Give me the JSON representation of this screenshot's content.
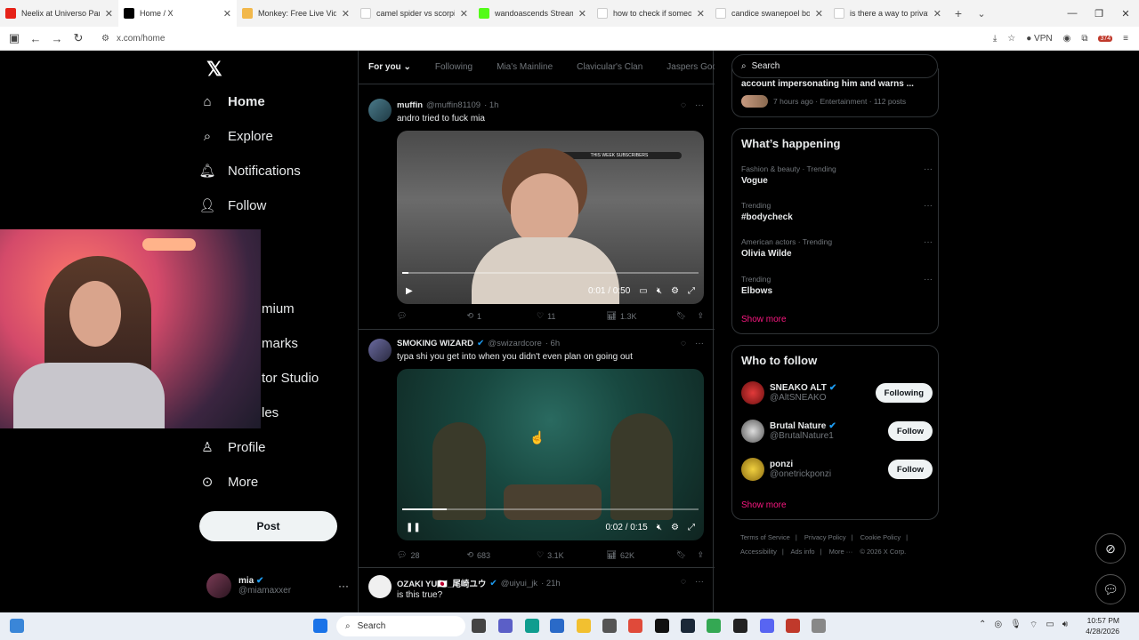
{
  "browser": {
    "tabs": [
      {
        "label": "Neelix at Universo Paralello",
        "color": "#e62117"
      },
      {
        "label": "Home / X",
        "color": "#000000"
      },
      {
        "label": "Monkey: Free Live Video Ch",
        "color": "#f2b84b"
      },
      {
        "label": "camel spider vs scorpion - G",
        "color": "#ffffff"
      },
      {
        "label": "wandoascends Stream - Wa",
        "color": "#53fc18"
      },
      {
        "label": "how to check if someone fo",
        "color": "#ffffff"
      },
      {
        "label": "candice swanepoel body - G",
        "color": "#ffffff"
      },
      {
        "label": "is there a way to private a li",
        "color": "#ffffff"
      }
    ],
    "url": "x.com/home",
    "vpn_label": "VPN",
    "badge_count": "374"
  },
  "x": {
    "nav": {
      "home": "Home",
      "explore": "Explore",
      "notifications": "Notifications",
      "follow": "Follow",
      "premium_partial": "mium",
      "bookmarks_partial": "marks",
      "creator_partial": "tor Studio",
      "articles_partial": "les",
      "profile": "Profile",
      "more": "More",
      "post": "Post"
    },
    "account": {
      "name": "mia",
      "handle": "@miamaxxer"
    },
    "tabs": [
      "For you",
      "Following",
      "Mia's Mainline",
      "Clavicular's Clan",
      "Jaspers Goon"
    ],
    "tweets": [
      {
        "name": "muffin",
        "handle": "@muffin81109",
        "time": "· 1h",
        "text": "andro tried to fuck mia",
        "video_time": "0:01 / 0:50",
        "video_progress": 0.02,
        "overlay_text": "THIS WEEK SUBSCRIBERS",
        "replies": "",
        "reposts": "1",
        "likes": "11",
        "views": "1.3K"
      },
      {
        "name": "SMOKING WIZARD",
        "handle": "@swizardcore",
        "time": "· 6h",
        "text": "typa shi you get into when you didn't even plan on going out",
        "video_time": "0:02 / 0:15",
        "video_progress": 0.15,
        "replies": "28",
        "reposts": "683",
        "likes": "3.1K",
        "views": "62K"
      },
      {
        "name": "OZAKI YU🇯🇵_尾崎ユウ",
        "handle": "@uiyui_jk",
        "time": "· 21h",
        "text": "is this true?"
      }
    ],
    "right": {
      "search_placeholder": "Search",
      "news_title_partial": "account impersonating him and warns ...",
      "news_meta": "7 hours ago · Entertainment · 112 posts",
      "happening_title": "What’s happening",
      "trends": [
        {
          "category": "Fashion & beauty · Trending",
          "title": "Vogue"
        },
        {
          "category": "Trending",
          "title": "#bodycheck"
        },
        {
          "category": "American actors · Trending",
          "title": "Olivia Wilde"
        },
        {
          "category": "Trending",
          "title": "Elbows"
        }
      ],
      "show_more": "Show more",
      "wtf_title": "Who to follow",
      "who_to_follow": [
        {
          "name": "SNEAKO ALT",
          "handle": "@AltSNEAKO",
          "button": "Following"
        },
        {
          "name": "Brutal Nature",
          "handle": "@BrutalNature1",
          "button": "Follow"
        },
        {
          "name": "ponzi",
          "handle": "@onetrickponzi",
          "button": "Follow"
        }
      ],
      "footer": [
        "Terms of Service",
        "|",
        "Privacy Policy",
        "|",
        "Cookie Policy",
        "|",
        "Accessibility",
        "|",
        "Ads info",
        "|",
        "More ···",
        "© 2026 X Corp."
      ]
    }
  },
  "taskbar": {
    "search": "Search",
    "time": "10:57 PM",
    "date": "4/28/2026"
  }
}
